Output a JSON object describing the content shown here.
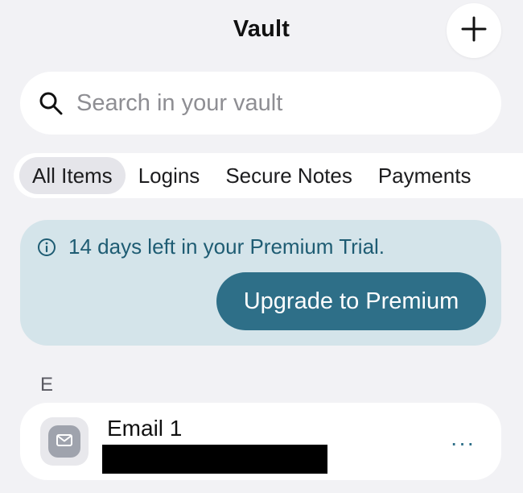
{
  "header": {
    "title": "Vault"
  },
  "search": {
    "placeholder": "Search in your vault",
    "value": ""
  },
  "filters": {
    "tabs": [
      {
        "label": "All Items",
        "active": true
      },
      {
        "label": "Logins",
        "active": false
      },
      {
        "label": "Secure Notes",
        "active": false
      },
      {
        "label": "Payments",
        "active": false
      }
    ]
  },
  "promo": {
    "message": "14 days left in your Premium Trial.",
    "button_label": "Upgrade to Premium"
  },
  "vault_list": {
    "sections": [
      {
        "letter": "E",
        "items": [
          {
            "title": "Email 1",
            "subtitle_redacted": true,
            "more_label": "···"
          }
        ]
      }
    ]
  },
  "colors": {
    "background": "#f2f2f5",
    "accent": "#2e6f88",
    "promo_background": "#d4e4ea",
    "promo_text": "#1e5c73"
  },
  "icons": {
    "add": "plus-icon",
    "search": "search-icon",
    "info": "info-icon",
    "item": "mail-icon",
    "more": "more-horizontal-icon"
  }
}
